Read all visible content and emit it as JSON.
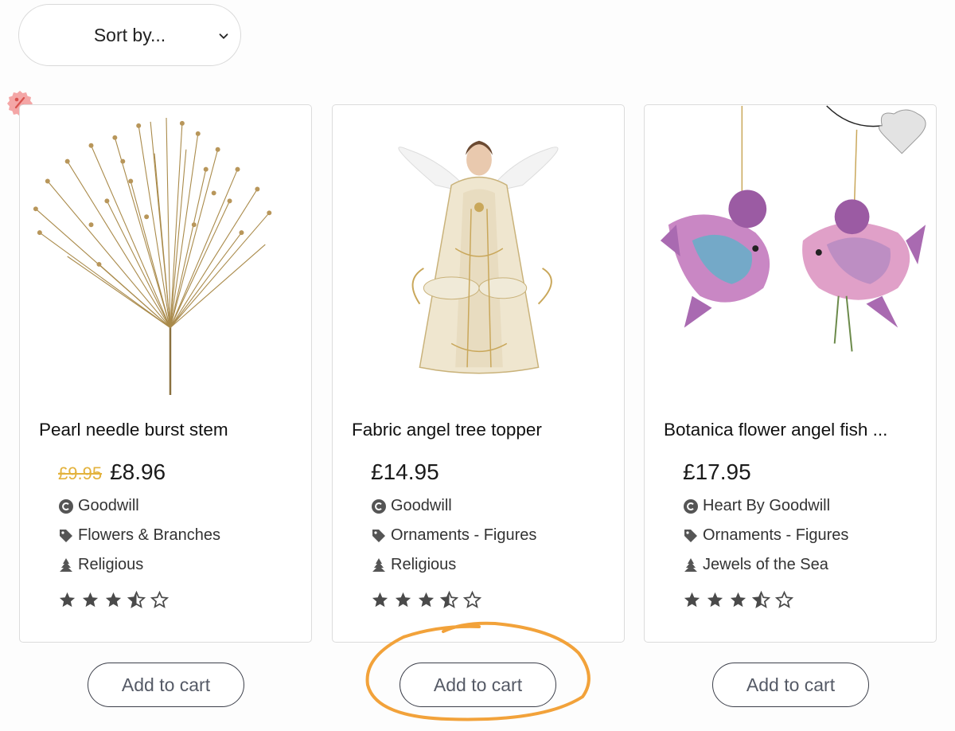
{
  "sort": {
    "label": "Sort by..."
  },
  "colors": {
    "accent_highlight": "#f2a23a",
    "sale_price": "#e3b23c",
    "sale_badge": "#f4a6a6"
  },
  "products": [
    {
      "title": "Pearl needle burst stem",
      "old_price": "£9.95",
      "price": "£8.96",
      "brand": "Goodwill",
      "category": "Flowers & Branches",
      "collection": "Religious",
      "rating": 3.5,
      "add_to_cart": "Add to cart"
    },
    {
      "title": "Fabric angel tree topper",
      "old_price": "",
      "price": "£14.95",
      "brand": "Goodwill",
      "category": "Ornaments - Figures",
      "collection": "Religious",
      "rating": 3.5,
      "add_to_cart": "Add to cart"
    },
    {
      "title": "Botanica flower angel fish ...",
      "old_price": "",
      "price": "£17.95",
      "brand": "Heart By Goodwill",
      "category": "Ornaments - Figures",
      "collection": "Jewels of the Sea",
      "rating": 3.5,
      "add_to_cart": "Add to cart"
    }
  ],
  "icons": {
    "brand": "copyright-circle-icon",
    "category": "tag-icon",
    "collection": "christmas-tree-icon",
    "sale": "percent-badge-icon"
  }
}
